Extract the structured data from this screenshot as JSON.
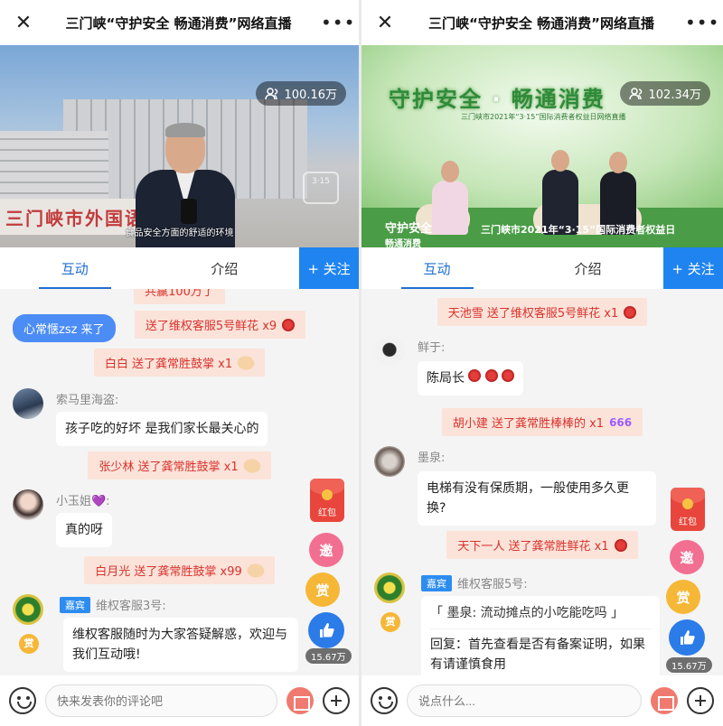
{
  "left": {
    "title": "三门峡“守护安全 畅通消费”网络直播",
    "viewers": "100.16万",
    "caption": "食品安全方面的舒适的环境",
    "wall_text": "三门峡市外国语",
    "tabs": {
      "interact": "互动",
      "intro": "介绍",
      "follow": "+ 关注"
    },
    "join_notice": "心常惬zsz 来了",
    "truncated_top": "共赢100万了",
    "gifts": [
      "送了维权客服5号鲜花 x9",
      "白白 送了龚常胜鼓掌 x1",
      "张少林 送了龚常胜鼓掌 x1",
      "白月光 送了龚常胜鼓掌 x99"
    ],
    "messages": [
      {
        "nick": "索马里海盗:",
        "text": "孩子吃的好坏 是我们家长最关心的"
      },
      {
        "nick": "小玉姐💜:",
        "text": "真的呀"
      },
      {
        "badge": "嘉宾",
        "nick": "维权客服3号:",
        "text": "维权客服随时为大家答疑解惑，欢迎与我们互动哦!"
      }
    ],
    "side": {
      "hongbao": "红包",
      "invite": "邀",
      "tip": "赏",
      "likes": "15.67万"
    },
    "input_placeholder": "快来发表你的评论吧",
    "reward_small": "赏"
  },
  "right": {
    "title": "三门峡“守护安全 畅通消费”网络直播",
    "viewers": "102.34万",
    "slogan_a": "守护安全",
    "slogan_b": "畅通消费",
    "slogan_sub": "三门峡市2021年“3·15”国际消费者权益日网络直播",
    "floor_a": "守护安全",
    "floor_b": "畅通消费",
    "floor_text": "三门峡市2021年“3·15”国际消费者权益日",
    "tabs": {
      "interact": "互动",
      "intro": "介绍",
      "follow": "+ 关注"
    },
    "gifts": [
      "天池雪 送了维权客服5号鲜花 x1",
      "胡小建 送了龚常胜棒棒的 x1",
      "天下一人 送了龚常胜鲜花 x1"
    ],
    "messages": [
      {
        "nick": "鲜于:",
        "text": "陈局长"
      },
      {
        "nick": "墨泉:",
        "text": "电梯有没有保质期，一般使用多久更换?"
      },
      {
        "badge": "嘉宾",
        "nick": "维权客服5号:",
        "quote": "「 墨泉: 流动摊点的小吃能吃吗 」",
        "text": "回复：首先查看是否有备案证明，如果有请谨慎食用"
      }
    ],
    "side": {
      "hongbao": "红包",
      "invite": "邀",
      "tip": "赏",
      "likes": "15.67万"
    },
    "input_placeholder": "说点什么...",
    "reward_small": "赏",
    "stick_text": "666"
  }
}
